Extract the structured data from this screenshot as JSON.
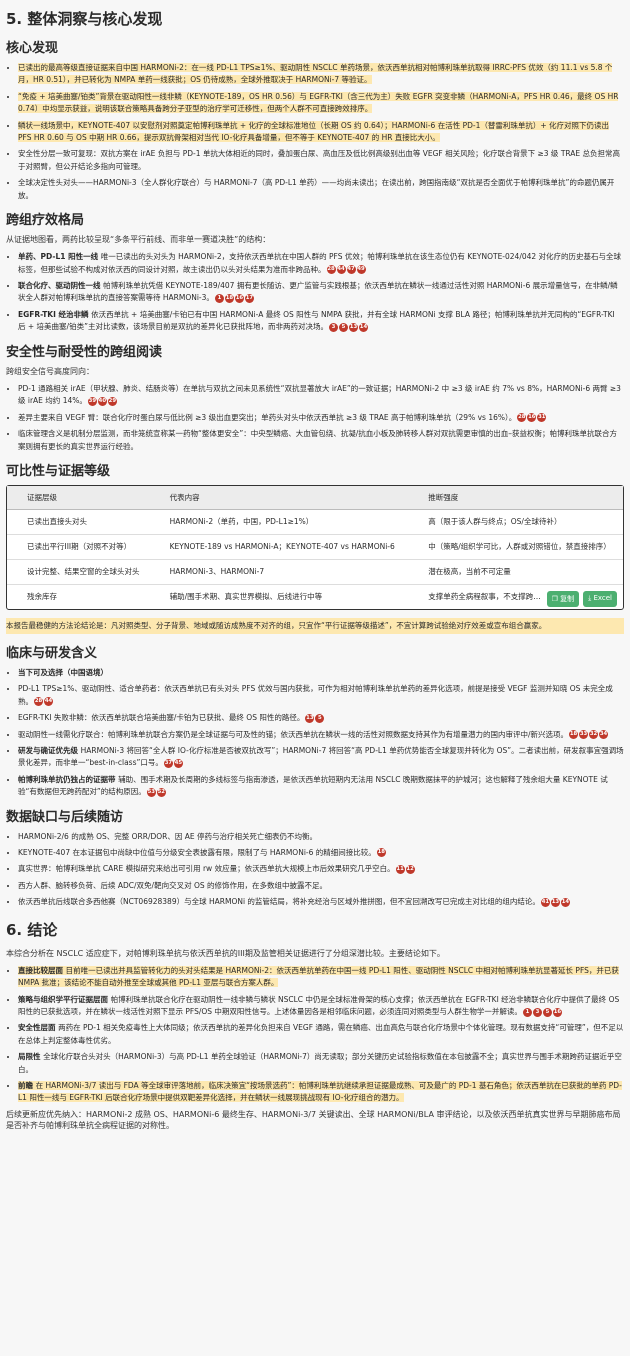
{
  "sec5": {
    "title": "5. 整体洞察与核心发现"
  },
  "core": {
    "title": "核心发现",
    "items": [
      {
        "text": "已读出的最高等级直接证据来自中国 HARMONi-2：在一线 PD-L1 TPS≥1%、驱动阴性 NSCLC 单药场景，依沃西单抗相对帕博利珠单抗取得 IRRC-PFS 优效（约 11.1 vs 5.8 个月，HR 0.51），并已转化为 NMPA 单药一线获批；OS 仍待成熟，全球外推取决于 HARMONi-7 等验证。"
      },
      {
        "text": "“免疫 + 培美曲塞/铂类”背景在驱动阳性一线非鳞（KEYNOTE-189，OS HR 0.56）与 EGFR-TKI（含三代为主）失败 EGFR 突变非鳞（HARMONi-A，PFS HR 0.46，最终 OS HR 0.74）中均显示获益，说明该联合策略具备跨分子亚型的治疗学可迁移性，但两个人群不可直接跨效排序。"
      },
      {
        "text": "鳞状一线场景中，KEYNOTE-407 以安慰剂对照奠定帕博利珠单抗 + 化疗的全球标准地位（长期 OS 约 0.64）；HARMONi-6 在活性 PD-1（替雷利珠单抗）+ 化疗对照下仍读出 PFS HR 0.60 与 OS 中期 HR 0.66，提示双抗骨架相对当代 IO-化疗具备增量，但不等于 KEYNOTE-407 的 HR 直接比大小。"
      },
      {
        "text": "安全性分层一致可复现：双抗方案在 irAE 负担与 PD-1 单抗大体相近的同时，叠加蛋白尿、高血压及低比例高级别出血等 VEGF 相关风险；化疗联合背景下 ≥3 级 TRAE 总负担常高于对照臂，但公开结论多指向可管理。"
      },
      {
        "text": "全球决定性头对头——HARMONi-3（全人群化疗联合）与 HARMONi-7（高 PD-L1 单药）——均尚未读出；在读出前，跨国指南级“双抗是否全面优于帕博利珠单抗”的命题仍属开放。"
      }
    ]
  },
  "cross": {
    "title": "跨组疗效格局",
    "lead": "从证据地图看，两药比较呈现“多条平行前线、而非单一赛道决胜”的结构：",
    "items": [
      {
        "head": "单药、PD-L1 阳性一线",
        "text": "唯一已读出的头对头为 HARMONi-2，支持依沃西单抗在中国人群的 PFS 优效；帕博利珠单抗在该生态位仍有 KEYNOTE-024/042 对化疗的历史基石与全球标签，但那些试验不构成对依沃西的同设计对照，故主读出仍以头对头结果为准而非跨品种。",
        "cites": [
          "28",
          "44",
          "47",
          "49"
        ]
      },
      {
        "head": "联合化疗、驱动阴性一线",
        "text": "帕博利珠单抗凭借 KEYNOTE-189/407 拥有更长随访、更广监管与实践根基；依沃西单抗在鳞状一线通过活性对照 HARMONi-6 展示增量信号，在非鳞/鳞状全人群对帕博利珠单抗的直接答案需等待 HARMONi-3。",
        "cites": [
          "1",
          "18",
          "16",
          "17"
        ]
      },
      {
        "head": "EGFR-TKI 经治非鳞",
        "text": "依沃西单抗 + 培美曲塞/卡铂已有中国 HARMONi-A 最终 OS 阳性与 NMPA 获批，并有全球 HARMONi 支撑 BLA 路径；帕博利珠单抗并无同构的“EGFR-TKI 后 + 培美曲塞/铂类”主对比读数，该场景目前是双抗的差异化已获批阵地，而非两药对决场。",
        "cites": [
          "3",
          "5",
          "13",
          "14"
        ]
      }
    ]
  },
  "safety": {
    "title": "安全性与耐受性的跨组阅读",
    "lead": "跨组安全信号高度同向：",
    "items": [
      {
        "text": "PD-1 通路相关 irAE（甲状腺、肺炎、结肠炎等）在单抗与双抗之间未见系统性“双抗显著放大 irAE”的一致证据；HARMONi-2 中 ≥3 级 irAE 约 7% vs 8%，HARMONi-6 两臂 ≥3 级 irAE 均约 14%。",
        "cites": [
          "39",
          "40",
          "29"
        ]
      },
      {
        "text": "差异主要来自 VEGF 臂：联合化疗时蛋白尿与低比例 ≥3 级出血更突出；单药头对头中依沃西单抗 ≥3 级 TRAE 高于帕博利珠单抗（29% vs 16%）。",
        "cites": [
          "28",
          "16",
          "31"
        ]
      },
      {
        "text": "临床管理含义是机制分层监测，而非笼统宣称某一药物“整体更安全”：中央型鳞癌、大血管包绕、抗凝/抗血小板及肺转移人群对双抗需更审慎的出血–获益权衡；帕博利珠单抗联合方案则拥有更长的真实世界运行经验。",
        "cites": []
      }
    ]
  },
  "evidence": {
    "title": "可比性与证据等级",
    "headers": [
      "证据层级",
      "代表内容",
      "推断强度"
    ],
    "rows": [
      [
        "已读出直接头对头",
        "HARMONi-2（单药，中国，PD-L1≥1%）",
        "高（限于该人群与终点；OS/全球待补）"
      ],
      [
        "已读出平行III期（对照不对等）",
        "KEYNOTE-189 vs HARMONi-A；KEYNOTE-407 vs HARMONi-6",
        "中（策略/组织学可比，人群或对照错位，禁直接排序）"
      ],
      [
        "设计完整、结果空窗的全球头对头",
        "HARMONi-3、HARMONi-7",
        "潜在极高，当前不可定量"
      ],
      [
        "残余库存",
        "辅助/围手术期、真实世界模拟、后线进行中等",
        "支撑单药全病程叙事，不支撑跨…"
      ]
    ],
    "copy_label": "复制",
    "excel_label": "Excel"
  },
  "note": "本报告最稳健的方法论结论是：凡对照类型、分子背景、地域或随访成熟度不对齐的组，只宜作“平行证据等级描述”，不宜计算跨试验绝对疗效差或宣布组合赢家。",
  "clinical": {
    "title": "临床与研发含义",
    "sub": "当下可及选择（中国语境）",
    "items": [
      {
        "head": "",
        "text": "PD-L1 TPS≥1%、驱动阴性、适合单药者：依沃西单抗已有头对头 PFS 优效与国内获批，可作为相对帕博利珠单抗单药的差异化选项，前提是接受 VEGF 监测并知晓 OS 未完全成熟。",
        "cites": [
          "28",
          "44"
        ]
      },
      {
        "head": "",
        "text": "EGFR-TKI 失败非鳞：依沃西单抗联合培美曲塞/卡铂为已获批、最终 OS 阳性的路径。",
        "cites": [
          "13",
          "5"
        ]
      },
      {
        "head": "",
        "text": "驱动阴性一线需化疗联合：帕博利珠单抗联合方案仍是全球证据与可及性的锚；依沃西单抗在鳞状一线的活性对照数据支持其作为有增量潜力的国内审评中/新兴选项。",
        "cites": [
          "18",
          "33",
          "32",
          "34"
        ]
      },
      {
        "head": "研发与确证优先级",
        "text": "HARMONi-3 将回答“全人群 IO-化疗标准是否被双抗改写”；HARMONi-7 将回答“高 PD-L1 单药优势能否全球复现并转化为 OS”。二者读出前，研发叙事宜强调场景化差异，而非单一“best-in-class”口号。",
        "cites": [
          "37",
          "45"
        ]
      },
      {
        "head": "帕博利珠单抗仍独占的证据带",
        "text": "辅助、围手术期及长周期的多线标签与指南渗透，是依沃西单抗短期内无法用 NSCLC 晚期数据抹平的护城河；这也解释了残余组大量 KEYNOTE 试验“有数据但无跨药配对”的结构原因。",
        "cites": [
          "53",
          "52"
        ]
      }
    ]
  },
  "gaps": {
    "title": "数据缺口与后续随访",
    "items": [
      {
        "text": "HARMONi-2/6 的成熟 OS、完整 ORR/DOR、因 AE 停药与治疗相关死亡细表仍不均衡。",
        "cites": []
      },
      {
        "text": "KEYNOTE-407 在本证据包中尚缺中位值与分级安全表披露有限，限制了与 HARMONi-6 的精细间接比较。",
        "cites": [
          "18"
        ]
      },
      {
        "text": "真实世界：帕博利珠单抗 CARE 模拟研究来给出可引用 rw 效应量；依沃西单抗大规模上市后效果研究几乎空白。",
        "cites": [
          "11",
          "12"
        ]
      },
      {
        "text": "西方人群、脑转移负荷、后续 ADC/双免/靶向交叉对 OS 的修饰作用，在多数组中披露不足。",
        "cites": []
      },
      {
        "text": "依沃西单抗后线联合多西他赛（NCT06928389）与全球 HARMONi 的监管结局，将补充经治与区域外推拼图，但不宜回溯改写已完成主对比组的组内结论。",
        "cites": [
          "41",
          "13",
          "14"
        ]
      }
    ]
  },
  "sec6": {
    "title": "6. 结论"
  },
  "concl": {
    "lead": "本综合分析在 NSCLC 适应症下，对帕博利珠单抗与依沃西单抗的III期及监管相关证据进行了分组深潜比较。主要结论如下。",
    "items": [
      {
        "head": "直接比较层面",
        "text": "目前唯一已读出并具监管转化力的头对头结果是 HARMONi-2：依沃西单抗单药在中国一线 PD-L1 阳性、驱动阴性 NSCLC 中相对帕博利珠单抗显著延长 PFS，并已获 NMPA 批准；该结论不能自动外推至全球或其他 PD-L1 亚层与联合方案人群。",
        "cites": [],
        "hl": true
      },
      {
        "head": "策略与组织学平行证据层面",
        "text": "帕博利珠单抗联合化疗在驱动阴性一线非鳞与鳞状 NSCLC 中仍是全球标准骨架的核心支撑；依沃西单抗在 EGFR-TKI 经治非鳞联合化疗中提供了最终 OS 阳性的已获批选项，并在鳞状一线活性对照下显示 PFS/OS 中期双阳性信号。上述体量因各是相邻临床问题，必须连同对照类型与人群生物学一并解读。",
        "cites": [
          "1",
          "3",
          "5",
          "16"
        ],
        "hl": false
      },
      {
        "head": "安全性层面",
        "text": "两药在 PD-1 相关免疫毒性上大体同级；依沃西单抗的差异化负担来自 VEGF 通路，需在鳞癌、出血高危与联合化疗场景中个体化管理。现有数据支持“可管理”，但不足以在总体上判定整体毒性优劣。",
        "cites": [],
        "hl": false
      },
      {
        "head": "局限性",
        "text": "全球化疗联合头对头（HARMONi-3）与高 PD-L1 单药全球验证（HARMONi-7）尚无读取；部分关键历史试验指标数值在本包披露不全；真实世界与围手术期跨药证据近乎空白。",
        "cites": [],
        "hl": false
      },
      {
        "head": "前瞻",
        "text": "在 HARMONi-3/7 读出与 FDA 等全球审评落地前，临床决策宜“按场景选药”：帕博利珠单抗继续承担证据最成熟、可及最广的 PD-1 基石角色；依沃西单抗在已获批的单药 PD-L1 阳性一线与 EGFR-TKI 后联合化疗场景中提供双靶差异化选择，并在鳞状一线展现挑战现有 IO-化疗组合的潜力。",
        "cites": [],
        "hl": true
      }
    ],
    "closing": "后续更新应优先纳入：HARMONi-2 成熟 OS、HARMONi-6 最终生存、HARMONi-3/7 关键读出、全球 HARMONi/BLA 审评结论，以及依沃西单抗真实世界与早期肺癌布局是否补齐与帕博利珠单抗全病程证据的对称性。"
  }
}
